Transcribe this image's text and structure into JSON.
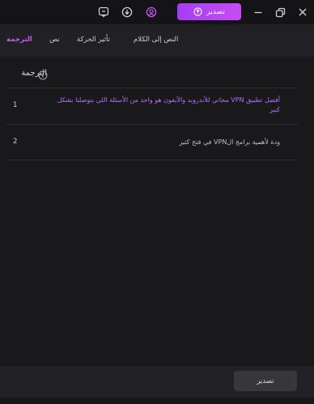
{
  "header": {
    "export_label": "تصدير"
  },
  "tabs": [
    {
      "label": "الترجمة",
      "active": true
    },
    {
      "label": "نص",
      "active": false
    },
    {
      "label": "تأثير الحركة",
      "active": false
    },
    {
      "label": "النص إلى الكلام",
      "active": false
    }
  ],
  "section": {
    "title": "الترجمة"
  },
  "rows": [
    {
      "index": "1",
      "text": "أفضل تطبيق VPN مجاني للأندرويد والآيفون هو واحد من الأسئلة اللي بتوصلنا بشكل كبير"
    },
    {
      "index": "2",
      "text": "ودة لأهمية برامج الVPN في فتح كتير"
    }
  ],
  "footer": {
    "export_label": "تصدير"
  },
  "colors": {
    "accent": "#b84af4",
    "background": "#19191c",
    "highlight_text": "#b26ff0"
  },
  "icons": [
    "message-icon",
    "download-icon",
    "user-icon",
    "upload-icon",
    "minimize-icon",
    "restore-icon",
    "close-icon",
    "info-icon"
  ]
}
